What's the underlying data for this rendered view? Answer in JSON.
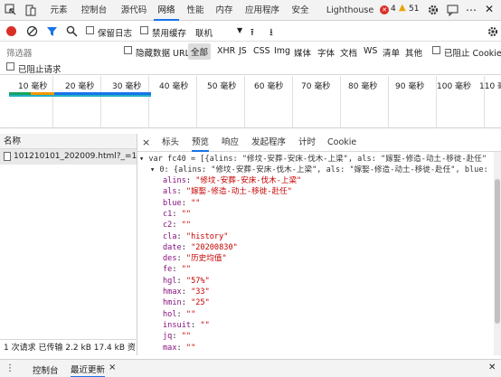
{
  "topbar": {
    "tabs": [
      "元素",
      "控制台",
      "源代码",
      "网络",
      "性能",
      "内存",
      "应用程序",
      "安全",
      "Lighthouse"
    ],
    "active_tab": "网络",
    "error_count": "4",
    "warning_count": "51"
  },
  "toolbar": {
    "preserve_log": "保留日志",
    "disable_cache": "禁用缓存",
    "throttle": "联机"
  },
  "filter": {
    "placeholder": "筛选器",
    "hide_data_urls": "隐藏数据 URL",
    "types": [
      "全部",
      "XHR",
      "JS",
      "CSS",
      "Img",
      "媒体",
      "字体",
      "文档",
      "WS",
      "清单",
      "其他"
    ],
    "active_type": "全部",
    "blocked_cookies": "已阻止 Cookie",
    "blocked_requests": "已阻止请求"
  },
  "timeline": {
    "ticks": [
      "10 毫秒",
      "20 毫秒",
      "30 毫秒",
      "40 毫秒",
      "50 毫秒",
      "60 毫秒",
      "70 毫秒",
      "80 毫秒",
      "90 毫秒",
      "100 毫秒",
      "110 毫"
    ]
  },
  "requests": {
    "header": "名称",
    "items": [
      "101210101_202009.html?_=16..."
    ],
    "status": "1 次请求  已传输 2.2 kB  17.4 kB 资"
  },
  "detail": {
    "close": "×",
    "tabs": [
      "标头",
      "预览",
      "响应",
      "发起程序",
      "计时",
      "Cookie"
    ],
    "active_tab": "预览",
    "line1": "var fc40 = [{alins: \"修坟-安葬-安床-伐木-上梁\", als: \"嫁娶-修造-动土-移徙-赴任\"",
    "line2": "0: {alins: \"修坟-安葬-安床-伐木-上梁\", als: \"嫁娶-修造-动土-移徙-赴任\", blue: \"\"",
    "fields": [
      {
        "k": "alins",
        "v": "\"修坟-安葬-安床-伐木-上梁\""
      },
      {
        "k": "als",
        "v": "\"嫁娶-修造-动土-移徙-赴任\""
      },
      {
        "k": "blue",
        "v": "\"\""
      },
      {
        "k": "c1",
        "v": "\"\""
      },
      {
        "k": "c2",
        "v": "\"\""
      },
      {
        "k": "cla",
        "v": "\"history\""
      },
      {
        "k": "date",
        "v": "\"20200830\""
      },
      {
        "k": "des",
        "v": "\"历史均值\""
      },
      {
        "k": "fe",
        "v": "\"\""
      },
      {
        "k": "hgl",
        "v": "\"57%\""
      },
      {
        "k": "hmax",
        "v": "\"33\""
      },
      {
        "k": "hmin",
        "v": "\"25\""
      },
      {
        "k": "hol",
        "v": "\"\""
      },
      {
        "k": "insuit",
        "v": "\"\""
      },
      {
        "k": "jq",
        "v": "\"\""
      },
      {
        "k": "max",
        "v": "\"\""
      }
    ]
  },
  "drawer": {
    "tabs": [
      "控制台",
      "最近更新"
    ],
    "active_tab": "最近更新"
  },
  "colors": {
    "accent": "#1a73e8",
    "record_red": "#d93025",
    "key_purple": "#881280",
    "string_red": "#c80000"
  }
}
